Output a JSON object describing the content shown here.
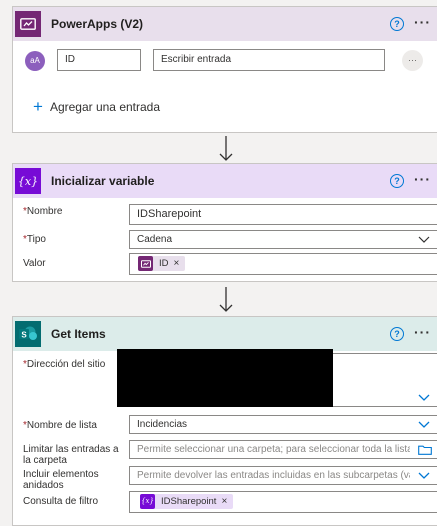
{
  "powerapps": {
    "title": "PowerApps (V2)",
    "help_icon": "?",
    "more": "···",
    "avatar_text": "aA",
    "input_name": "ID",
    "input_desc": "Escribir entrada",
    "row_more": "···",
    "add_label": "Agregar una entrada",
    "add_icon": "+",
    "color": "#742774"
  },
  "init_var": {
    "title": "Inicializar variable",
    "icon_text": "{x}",
    "color": "#770bd6",
    "fields": {
      "name_label": "Nombre",
      "name_value": "IDSharepoint",
      "type_label": "Tipo",
      "type_value": "Cadena",
      "value_label": "Valor",
      "value_token": "ID",
      "token_close": "×"
    }
  },
  "get_items": {
    "title": "Get Items",
    "icon_text": "S",
    "color": "#036c70",
    "fields": {
      "site_label": "Dirección del sitio",
      "list_label": "Nombre de lista",
      "list_value": "Incidencias",
      "limit_label": "Limitar las entradas a la carpeta",
      "limit_placeholder": "Permite seleccionar una carpeta; para seleccionar toda la lista, deje este v",
      "include_label": "Incluir elementos anidados",
      "include_placeholder": "Permite devolver las entradas incluidas en las subcarpetas (valor predeter",
      "filter_label": "Consulta de filtro",
      "filter_token": "IDSharepoint",
      "token_close": "×"
    }
  },
  "required_mark": "*"
}
